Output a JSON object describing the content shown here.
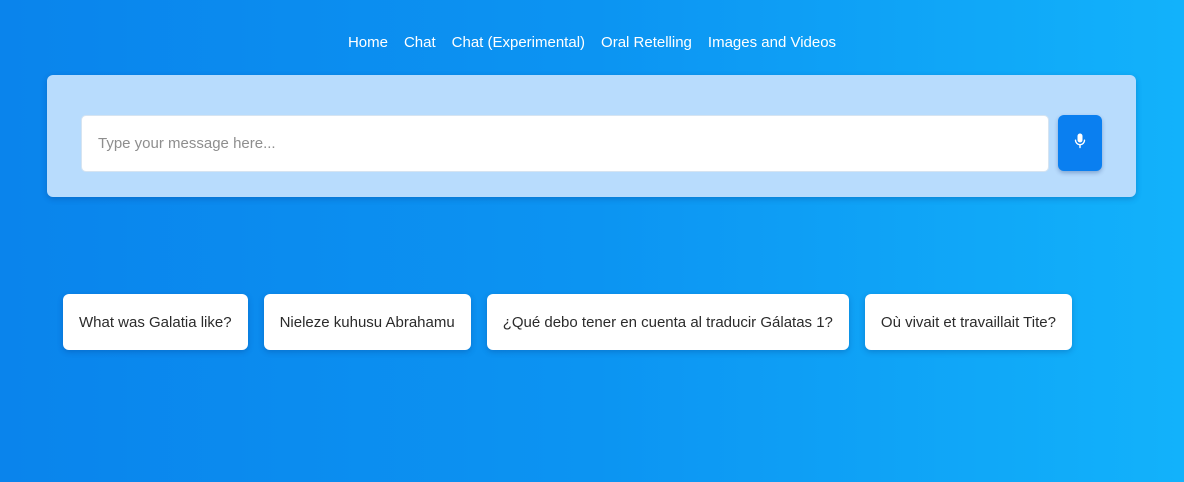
{
  "nav": {
    "items": [
      {
        "label": "Home"
      },
      {
        "label": "Chat"
      },
      {
        "label": "Chat (Experimental)"
      },
      {
        "label": "Oral Retelling"
      },
      {
        "label": "Images and Videos"
      }
    ]
  },
  "chat": {
    "input_placeholder": "Type your message here...",
    "input_value": "",
    "mic_icon": "microphone-icon"
  },
  "suggestions": [
    {
      "label": "What was Galatia like?"
    },
    {
      "label": "Nieleze kuhusu Abrahamu"
    },
    {
      "label": "¿Qué debo tener en cuenta al traducir Gálatas 1?"
    },
    {
      "label": "Où vivait et travaillait Tite?"
    }
  ],
  "colors": {
    "background_start": "#0a84ec",
    "background_end": "#12b2fb",
    "panel": "#b8dcfd",
    "mic_button": "#0a7ff0",
    "chip": "#ffffff"
  }
}
